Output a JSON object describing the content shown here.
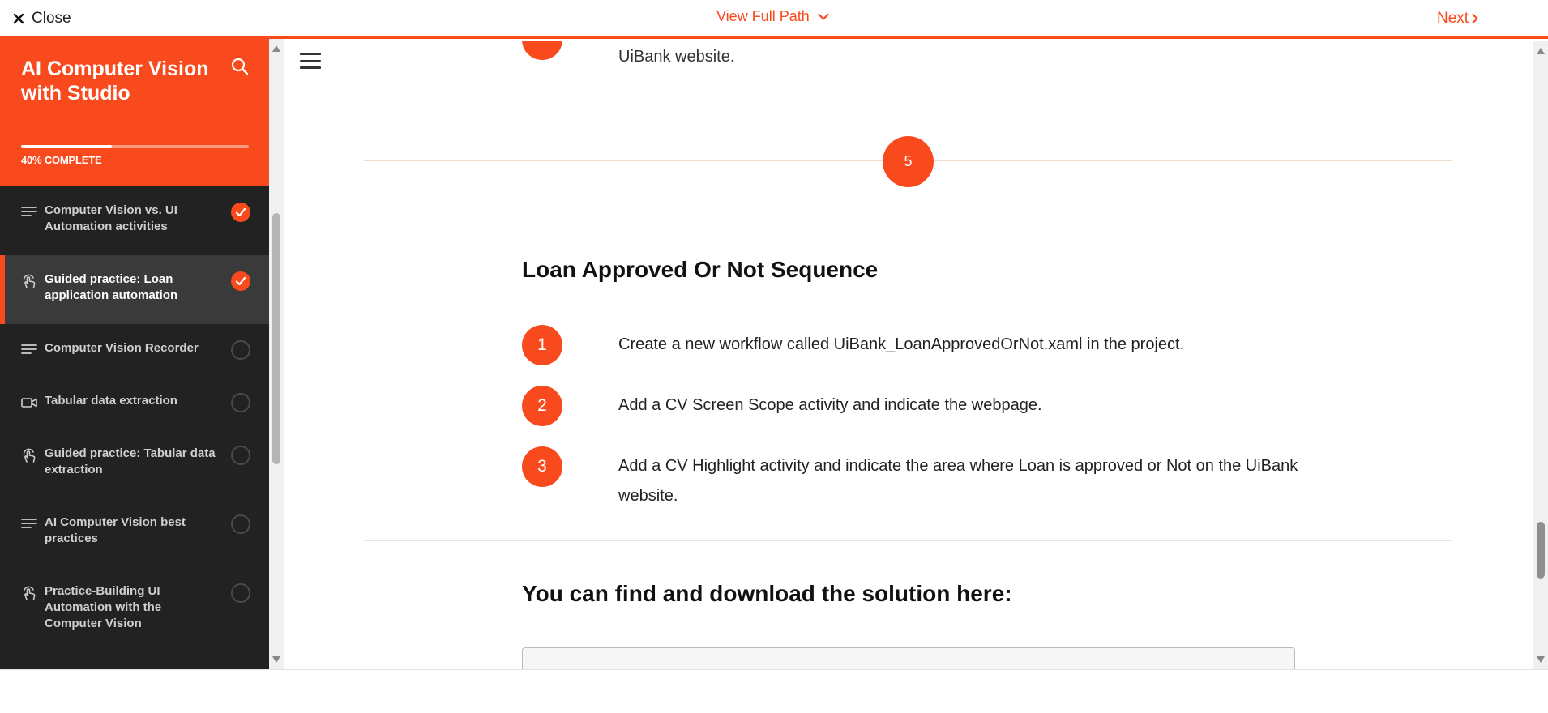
{
  "topbar": {
    "close_label": "Close",
    "view_path_label": "View Full Path",
    "next_label": "Next"
  },
  "sidebar": {
    "course_title": "AI Computer Vision with Studio",
    "progress_percent": 40,
    "progress_label": "40% COMPLETE",
    "lessons": [
      {
        "label": "Computer Vision vs. UI Automation activities",
        "icon": "text-lines-icon",
        "status": "complete",
        "active": false
      },
      {
        "label": "Guided practice: Loan application automation",
        "icon": "hand-touch-icon",
        "status": "complete",
        "active": true
      },
      {
        "label": "Computer Vision Recorder",
        "icon": "text-lines-icon",
        "status": "incomplete",
        "active": false
      },
      {
        "label": "Tabular data extraction",
        "icon": "video-icon",
        "status": "incomplete",
        "active": false
      },
      {
        "label": "Guided practice: Tabular data extraction",
        "icon": "hand-touch-icon",
        "status": "incomplete",
        "active": false
      },
      {
        "label": "AI Computer Vision best practices",
        "icon": "text-lines-icon",
        "status": "incomplete",
        "active": false
      },
      {
        "label": "Practice-Building UI Automation with the Computer Vision",
        "icon": "hand-touch-icon",
        "status": "incomplete",
        "active": false
      }
    ]
  },
  "content": {
    "previous_step_tail": "UiBank website.",
    "section_number": "5",
    "section_title": "Loan Approved Or Not Sequence",
    "steps": [
      {
        "num": "1",
        "text": "Create a new workflow called UiBank_LoanApprovedOrNot.xaml in the project."
      },
      {
        "num": "2",
        "text": "Add a CV Screen Scope activity and indicate the webpage."
      },
      {
        "num": "3",
        "text": "Add a CV Highlight activity and indicate the area where Loan is approved or Not on the UiBank website."
      }
    ],
    "download_heading": "You can find and download the solution here:"
  },
  "colors": {
    "accent": "#f94a1e",
    "sidebar_bg": "#222222",
    "sidebar_active_bg": "#3a3a3a"
  }
}
